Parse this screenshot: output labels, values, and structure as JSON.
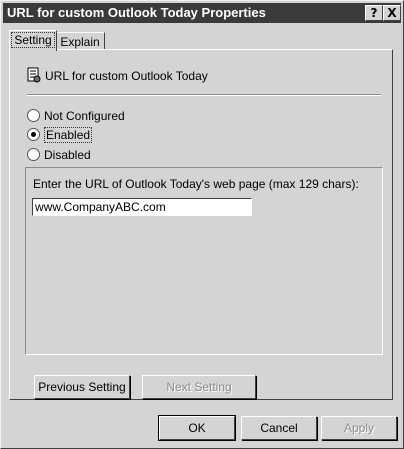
{
  "window": {
    "title": "URL for custom Outlook Today Properties",
    "help_button": "?",
    "close_button": "X"
  },
  "tabs": [
    {
      "label": "Setting",
      "active": true
    },
    {
      "label": "Explain",
      "active": false
    }
  ],
  "policy": {
    "icon": "policy-setting-icon",
    "title": "URL for custom Outlook Today"
  },
  "options": [
    {
      "label": "Not Configured",
      "selected": false
    },
    {
      "label": "Enabled",
      "selected": true
    },
    {
      "label": "Disabled",
      "selected": false
    }
  ],
  "url_field": {
    "label": "Enter the URL of Outlook Today's web page (max 129 chars):",
    "value": "www.CompanyABC.com"
  },
  "navigation": {
    "previous": "Previous Setting",
    "next": "Next Setting"
  },
  "footer": {
    "ok": "OK",
    "cancel": "Cancel",
    "apply": "Apply"
  }
}
